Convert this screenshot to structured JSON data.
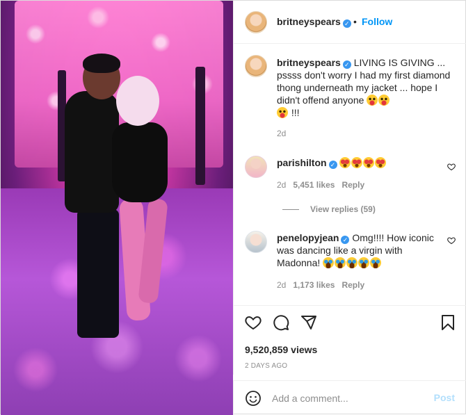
{
  "post": {
    "author": "britneyspears",
    "follow_label": "Follow",
    "separator": "•"
  },
  "caption": {
    "username": "britneyspears",
    "text": "LIVING IS GIVING ... pssss don't worry I had my first diamond thong underneath my jacket ... hope I didn't offend anyone",
    "emojis": [
      "face-with-tongue",
      "face-with-tongue",
      "face-with-tongue"
    ],
    "trailing": "!!!",
    "age": "2d"
  },
  "comments": [
    {
      "username": "parishilton",
      "text": "",
      "emojis": [
        "star-struck",
        "star-struck",
        "star-struck",
        "star-struck"
      ],
      "age": "2d",
      "likes": "5,451 likes",
      "reply_label": "Reply",
      "view_replies": "View replies (59)"
    },
    {
      "username": "penelopyjean",
      "text": "Omg!!!! How iconic was dancing like a virgin with Madonna!",
      "emojis": [
        "loudly-crying",
        "loudly-crying",
        "loudly-crying",
        "loudly-crying",
        "loudly-crying"
      ],
      "age": "2d",
      "likes": "1,173 likes",
      "reply_label": "Reply"
    }
  ],
  "stats": {
    "views": "9,520,859 views",
    "posted": "2 DAYS AGO"
  },
  "comment_box": {
    "placeholder": "Add a comment...",
    "post_label": "Post"
  },
  "icons": {
    "verified": "verified-badge-icon",
    "like": "heart-icon",
    "comment": "comment-bubble-icon",
    "share": "send-plane-icon",
    "save": "bookmark-icon",
    "emoji": "smiley-icon"
  },
  "colors": {
    "link_blue": "#0095f6",
    "verified_blue": "#3897f0",
    "muted_text": "#8e8e8e",
    "post_disabled": "#b2dffc"
  }
}
